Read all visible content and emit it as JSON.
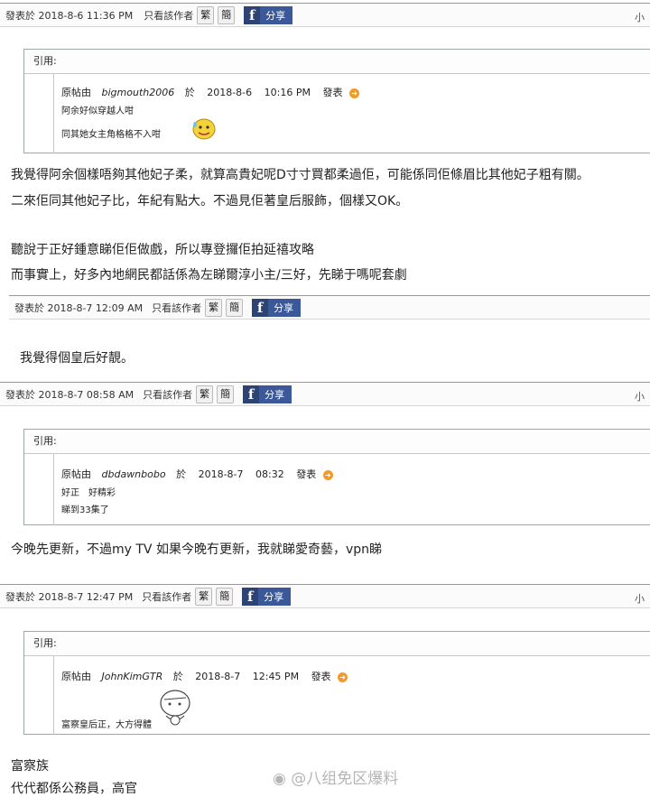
{
  "ui": {
    "trad_btn": "繁",
    "simp_btn": "簡",
    "share_label": "分享",
    "fb_letter": "f",
    "only_author": "只看該作者",
    "quote_label": "引用:",
    "orig_prefix": "原帖由",
    "orig_at": "於",
    "orig_post": "發表",
    "right_mark": "小"
  },
  "posts": [
    {
      "timestamp": "發表於 2018-8-6 11:36 PM",
      "quote": {
        "author": "bigmouth2006",
        "date": "2018-8-6",
        "time": "10:16 PM",
        "lines": [
          "阿余好似穿越人咁",
          "同其她女主角格格不入咁"
        ]
      },
      "body": [
        "我覺得阿余個樣唔夠其他妃子柔，就算高貴妃呢D寸寸買都柔過佢，可能係同佢條眉比其他妃子粗有關。",
        "二來佢同其他妃子比，年紀有點大。不過見佢著皇后服飾，個樣又OK。",
        "聽說于正好鍾意睇佢佢做戲，所以專登攞佢拍延禧攻略",
        "而事實上，好多內地網民都話係為左睇爾淳小主/三好，先睇于嗎呢套劇"
      ]
    },
    {
      "timestamp": "發表於 2018-8-7 12:09 AM",
      "body": [
        "我覺得個皇后好靚。"
      ]
    },
    {
      "timestamp": "發表於 2018-8-7 08:58 AM",
      "quote": {
        "author": "dbdawnbobo",
        "date": "2018-8-7",
        "time": "08:32",
        "lines": [
          "好正　好精彩",
          "睇到33集了"
        ]
      },
      "body": [
        "今晚先更新，不過my  TV  如果今晚冇更新，我就睇愛奇藝，vpn睇"
      ]
    },
    {
      "timestamp": "發表於 2018-8-7 12:47 PM",
      "quote": {
        "author": "JohnKimGTR",
        "date": "2018-8-7",
        "time": "12:45 PM",
        "lines": [
          "富察皇后正，大方得體"
        ]
      },
      "body": [
        "富察族",
        "代代都係公務員，高官"
      ]
    }
  ],
  "watermark": "@八组免区爆料",
  "colors": {
    "facebook": "#3b5998",
    "post_icon": "#f09a2a"
  }
}
